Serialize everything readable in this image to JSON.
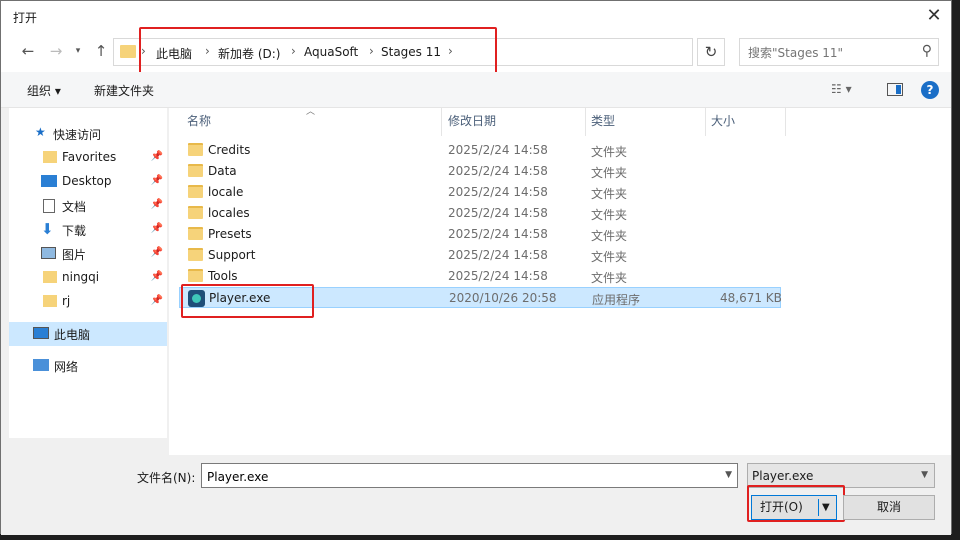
{
  "window": {
    "title": "打开",
    "close_glyph": "✕"
  },
  "nav": {
    "back_icon": "back-arrow-icon",
    "forward_icon": "forward-arrow-icon",
    "recent_icon": "chevron-down-icon",
    "up_icon": "up-arrow-icon",
    "breadcrumbs": [
      "此电脑",
      "新加卷 (D:)",
      "AquaSoft",
      "Stages 11"
    ],
    "search_placeholder": "搜索\"Stages 11\""
  },
  "toolbar": {
    "organize": "组织 ▾",
    "new_folder": "新建文件夹"
  },
  "sidebar": {
    "quick_access": "快速访问",
    "items": [
      {
        "label": "Favorites",
        "icon": "folder-icon"
      },
      {
        "label": "Desktop",
        "icon": "desktop-icon"
      },
      {
        "label": "文档",
        "icon": "document-icon"
      },
      {
        "label": "下载",
        "icon": "download-icon"
      },
      {
        "label": "图片",
        "icon": "pictures-icon"
      },
      {
        "label": "ningqi",
        "icon": "folder-icon"
      },
      {
        "label": "rj",
        "icon": "folder-icon"
      }
    ],
    "this_pc": "此电脑",
    "network": "网络"
  },
  "columns": {
    "name": "名称",
    "modified": "修改日期",
    "type": "类型",
    "size": "大小"
  },
  "files": [
    {
      "name": "Credits",
      "modified": "2025/2/24 14:58",
      "type": "文件夹",
      "size": ""
    },
    {
      "name": "Data",
      "modified": "2025/2/24 14:58",
      "type": "文件夹",
      "size": ""
    },
    {
      "name": "locale",
      "modified": "2025/2/24 14:58",
      "type": "文件夹",
      "size": ""
    },
    {
      "name": "locales",
      "modified": "2025/2/24 14:58",
      "type": "文件夹",
      "size": ""
    },
    {
      "name": "Presets",
      "modified": "2025/2/24 14:58",
      "type": "文件夹",
      "size": ""
    },
    {
      "name": "Support",
      "modified": "2025/2/24 14:58",
      "type": "文件夹",
      "size": ""
    },
    {
      "name": "Tools",
      "modified": "2025/2/24 14:58",
      "type": "文件夹",
      "size": ""
    },
    {
      "name": "Player.exe",
      "modified": "2020/10/26 20:58",
      "type": "应用程序",
      "size": "48,671 KB"
    }
  ],
  "bottom": {
    "filename_label": "文件名(N):",
    "filename_value": "Player.exe",
    "filter_value": "Player.exe",
    "open_label": "打开(O)",
    "cancel_label": "取消"
  }
}
